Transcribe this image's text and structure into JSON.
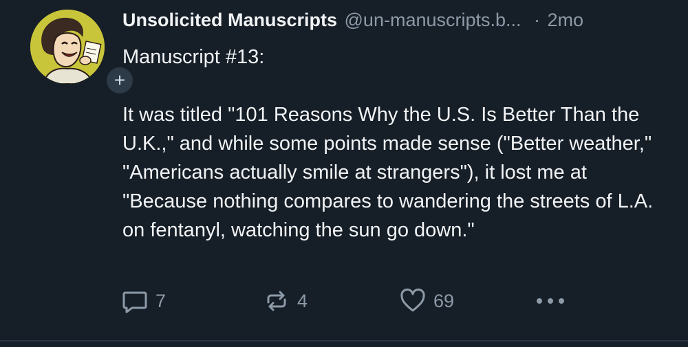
{
  "post": {
    "author": {
      "display_name": "Unsolicited Manuscripts",
      "handle": "@un-manuscripts.b...",
      "avatar_icon": "vintage-cartoon-woman-avatar",
      "follow_icon": "plus-icon",
      "follow_label": "+"
    },
    "separator": "·",
    "timestamp": "2mo",
    "text": "Manuscript #13:\n\nIt was titled \"101 Reasons Why the U.S. Is Better Than the U.K.,\" and while some points made sense (\"Better weather,\" \"Americans actually smile at strangers\"), it lost me at \"Because nothing compares to wandering the streets of L.A. on fentanyl, watching the sun go down.\"",
    "actions": {
      "reply": {
        "icon": "reply-icon",
        "count": "7"
      },
      "repost": {
        "icon": "repost-icon",
        "count": "4"
      },
      "like": {
        "icon": "heart-icon",
        "count": "69"
      },
      "more": {
        "icon": "more-dots-icon"
      }
    }
  },
  "colors": {
    "background": "#161e27",
    "text_primary": "#f1f3f5",
    "text_secondary": "#8d9aa8",
    "avatar_bg": "#c9c53a"
  }
}
